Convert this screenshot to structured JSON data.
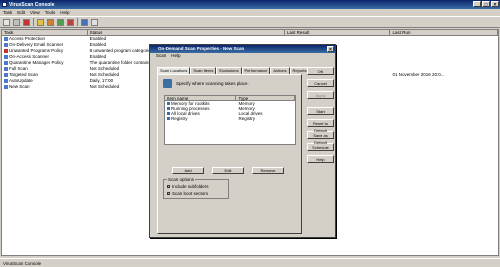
{
  "app": {
    "title": "VirusScan Console"
  },
  "menu": [
    "Task",
    "Edit",
    "View",
    "Tools",
    "Help"
  ],
  "columns": [
    "Task",
    "Status",
    "Last Result",
    "Last Run"
  ],
  "tasks": [
    {
      "task": "Access Protection",
      "status": "Enabled",
      "result": "",
      "lastrun": ""
    },
    {
      "task": "On-Delivery Email Scanner",
      "status": "Enabled",
      "result": "",
      "lastrun": ""
    },
    {
      "task": "Unwanted Programs Policy",
      "status": "8 unwanted program categories",
      "result": "",
      "lastrun": ""
    },
    {
      "task": "On-Access Scanner",
      "status": "Enabled",
      "result": "",
      "lastrun": ""
    },
    {
      "task": "Quarantine Manager Policy",
      "status": "The quarantine folder contains 0",
      "result": "",
      "lastrun": ""
    },
    {
      "task": "Full Scan",
      "status": "Not Scheduled",
      "result": "",
      "lastrun": ""
    },
    {
      "task": "Targeted Scan",
      "status": "Not Scheduled",
      "result": "",
      "lastrun": "01 November 2016 20:0..."
    },
    {
      "task": "AutoUpdate",
      "status": "Daily, 17:00",
      "result": "",
      "lastrun": ""
    },
    {
      "task": "New Scan",
      "status": "Not Scheduled",
      "result": "",
      "lastrun": ""
    }
  ],
  "statusbar": "VirusScan Console",
  "dialog": {
    "title": "On-Demand Scan Properties - New Scan",
    "menu": [
      "Scan",
      "Help"
    ],
    "tabs": [
      "Scan Locations",
      "Scan Items",
      "Exclusions",
      "Performance",
      "Actions",
      "Reports"
    ],
    "description": "Specify where scanning takes place.",
    "item_columns": [
      "Item name",
      "Type"
    ],
    "items": [
      {
        "name": "Memory for rootkits",
        "type": "Memory"
      },
      {
        "name": "Running processes",
        "type": "Memory"
      },
      {
        "name": "All local drives",
        "type": "Local drives"
      },
      {
        "name": "Registry",
        "type": "Registry"
      }
    ],
    "buttons": {
      "add": "Add",
      "edit": "Edit",
      "remove": "Remove"
    },
    "scan_options_label": "Scan options",
    "options": [
      "Include subfolders",
      "Scan boot sectors"
    ],
    "right_buttons": [
      "OK",
      "Cancel",
      "Apply",
      "Start",
      "Reset to Default",
      "Save as Default",
      "Schedule",
      "Help"
    ]
  }
}
